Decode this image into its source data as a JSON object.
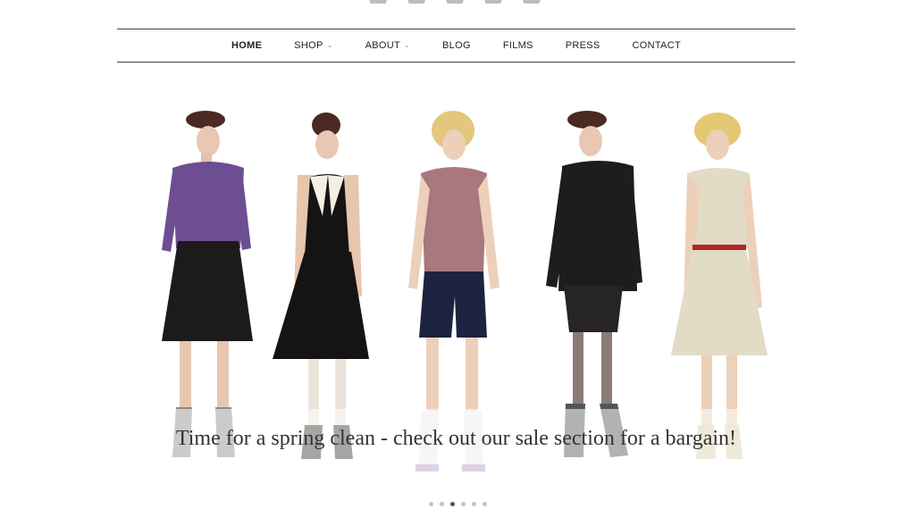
{
  "nav": {
    "items": [
      {
        "label": "HOME",
        "active": true,
        "has_submenu": false
      },
      {
        "label": "SHOP",
        "active": false,
        "has_submenu": true
      },
      {
        "label": "ABOUT",
        "active": false,
        "has_submenu": true
      },
      {
        "label": "BLOG",
        "active": false,
        "has_submenu": false
      },
      {
        "label": "FILMS",
        "active": false,
        "has_submenu": false
      },
      {
        "label": "PRESS",
        "active": false,
        "has_submenu": false
      },
      {
        "label": "CONTACT",
        "active": false,
        "has_submenu": false
      }
    ]
  },
  "slider": {
    "caption": "Time for a spring clean - check out our sale section for a bargain!",
    "slide_count": 6,
    "active_slide": 3
  }
}
